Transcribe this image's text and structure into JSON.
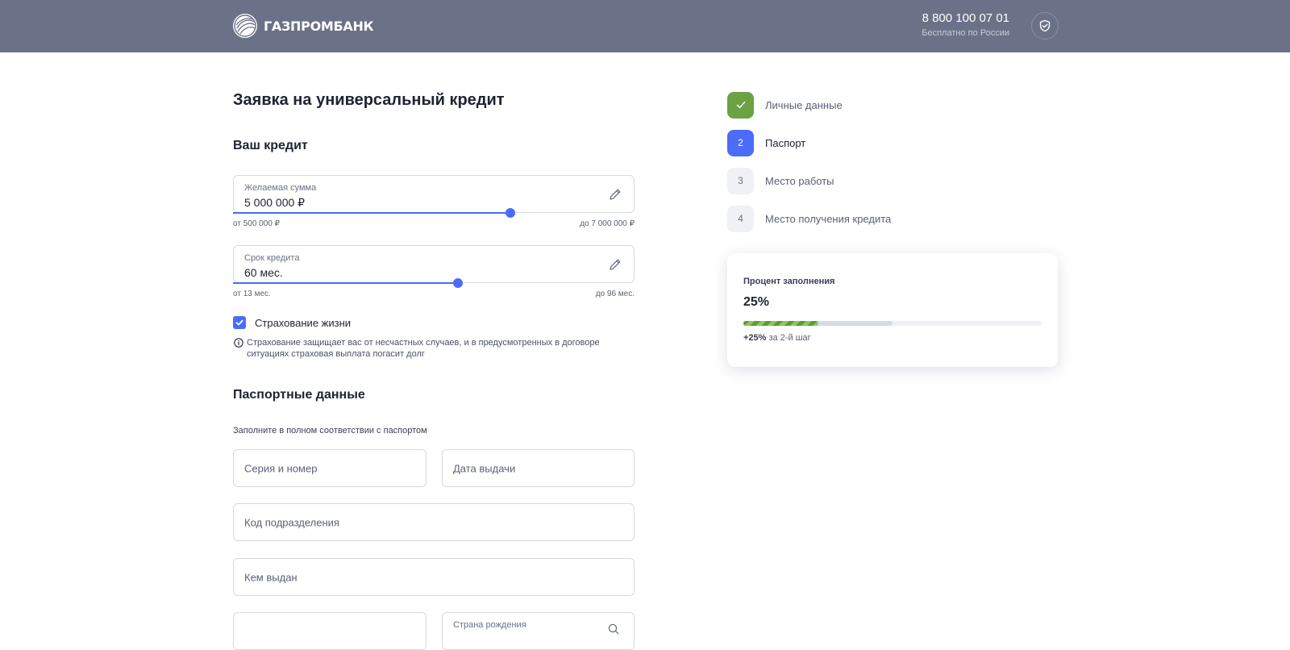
{
  "header": {
    "logo_text": "ГАЗПРОМБАНК",
    "phone": "8 800 100 07 01",
    "phone_note": "Бесплатно по России",
    "colors": {
      "header_bg": "#6b7187",
      "accent": "#4a6cf7",
      "done": "#6aa244"
    }
  },
  "form": {
    "title": "Заявка на универсальный кредит",
    "credit_section": "Ваш кредит",
    "amount": {
      "label": "Желаемая сумма",
      "value": "5 000 000 ₽",
      "min_label": "от 500 000 ₽",
      "max_label": "до 7 000 000 ₽",
      "level": 0.69
    },
    "term": {
      "label": "Срок кредита",
      "value": "60 мес.",
      "min_label": "от 13 мес.",
      "max_label": "до 96 мес.",
      "level": 0.56
    },
    "insurance": {
      "label": "Страхование жизни",
      "checked": true,
      "info": "Страхование защищает вас от несчастных случаев, и в предусмотренных в договоре ситуациях страховая выплата погасит долг"
    },
    "passport_section": "Паспортные данные",
    "passport_hint": "Заполните в полном соответствии с паспортом",
    "fields": {
      "series_number": "Серия и номер",
      "issue_date": "Дата выдачи",
      "division_code": "Код подразделения",
      "issued_by": "Кем выдан",
      "birth_country": "Страна рождения"
    }
  },
  "steps": [
    {
      "number": "✓",
      "label": "Личные данные",
      "state": "done"
    },
    {
      "number": "2",
      "label": "Паспорт",
      "state": "active"
    },
    {
      "number": "3",
      "label": "Место работы",
      "state": "todo"
    },
    {
      "number": "4",
      "label": "Место получения кредита",
      "state": "todo"
    }
  ],
  "progress": {
    "title": "Процент заполнения",
    "value": "25%",
    "fraction": 0.25,
    "next_fraction": 0.5,
    "note_bold": "+25%",
    "note_rest": " за 2-й шаг"
  }
}
